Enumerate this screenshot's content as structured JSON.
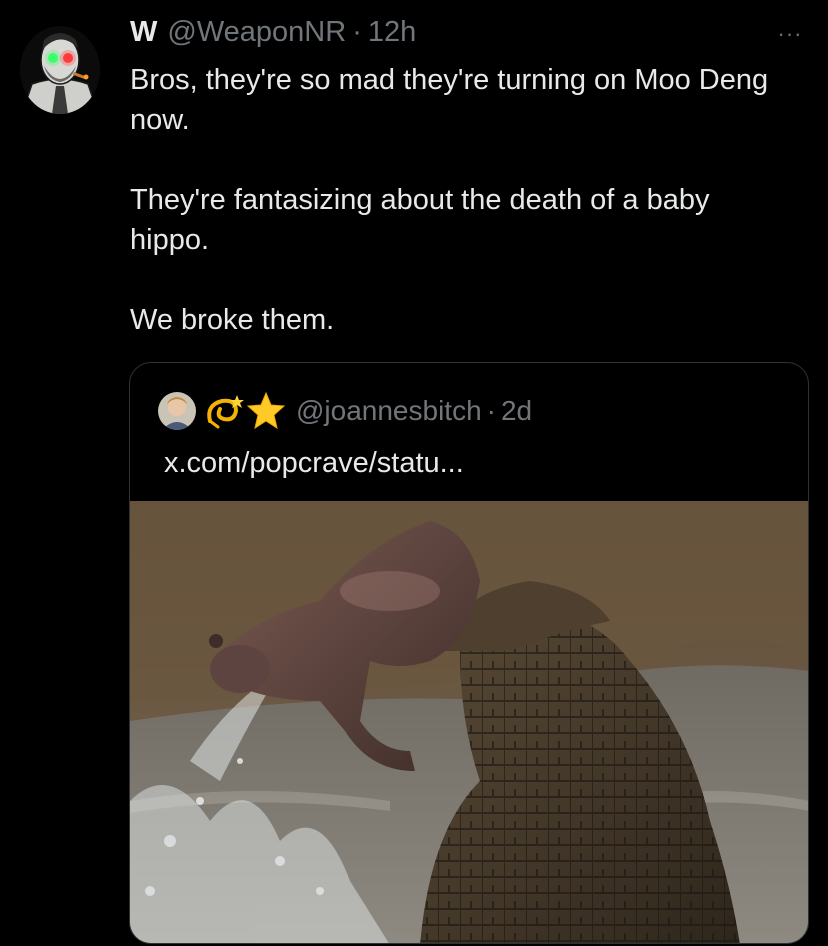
{
  "tweet": {
    "display_name": "W",
    "handle": "@WeaponNR",
    "separator": "·",
    "time": "12h",
    "more_icon": "···",
    "paragraphs": [
      "Bros, they're so mad they're turning on Moo Deng now.",
      "They're fantasizing about the death of a baby hippo.",
      "We broke them."
    ]
  },
  "quote": {
    "handle": "@joannesbitch",
    "separator": "·",
    "time": "2d",
    "text": "x.com/popcrave/statu...",
    "name_emojis": [
      "dizzy-icon",
      "star-icon"
    ],
    "media": "photo-crocodile-attacking-baby-hippo"
  },
  "colors": {
    "background": "#000000",
    "text_primary": "#e7e9ea",
    "text_secondary": "#71767b",
    "border": "#2f3336"
  }
}
